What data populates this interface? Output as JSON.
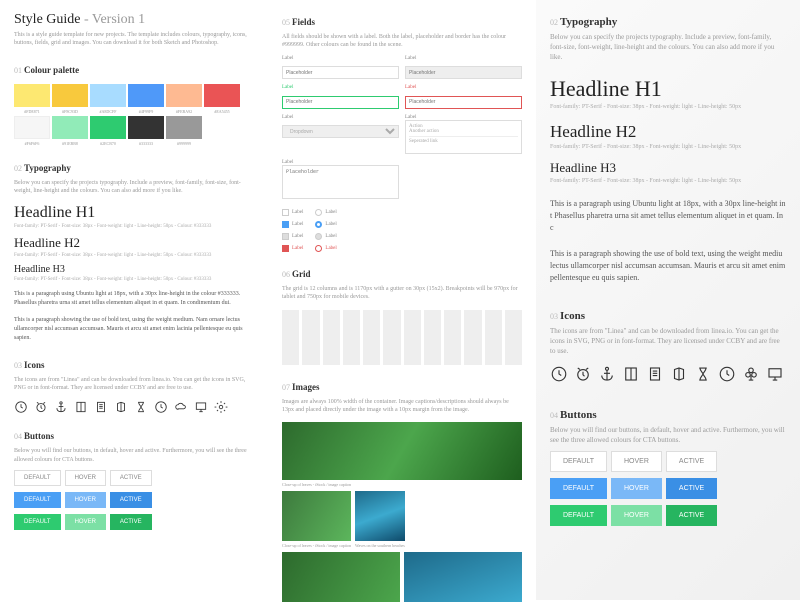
{
  "title": "Style Guide",
  "version": "- Version 1",
  "intro": "This is a style guide template for new projects. The template includes colours, typography, icons, buttons, fields, grid and images. You can download it for both Sketch and Photoshop.",
  "sections": {
    "palette": {
      "num": "01",
      "title": "Colour palette"
    },
    "typography": {
      "num": "02",
      "title": "Typography",
      "sub": "Below you can specify the projects typography. Include a preview, font-family, font-size, font-weight, line-height and the colours. You can also add more if you like."
    },
    "icons": {
      "num": "03",
      "title": "Icons",
      "sub": "The icons are from \"Linea\" and can be downloaded from linea.io. You can get the icons in SVG, PNG or in font-format. They are licensed under CCBY and are free to use."
    },
    "buttons": {
      "num": "04",
      "title": "Buttons",
      "sub": "Below you will find our buttons, in default, hover and active. Furthermore, you will see the three allowed colours for CTA buttons."
    },
    "fields": {
      "num": "05",
      "title": "Fields",
      "sub": "All fields should be shown with a label. Both the label, placeholder and border has the colour #999999. Other colours can be found in the scene."
    },
    "grid": {
      "num": "06",
      "title": "Grid",
      "sub": "The grid is 12 columns and is 1170px with a gutter on 30px (15x2). Breakpoints will be 970px for tablet and 750px for mobile devices."
    },
    "images": {
      "num": "07",
      "title": "Images",
      "sub": "Images are always 100% width of the container. Image captions/descriptions should always be 13px and placed directly under the image with a 10px margin from the image."
    }
  },
  "palette": [
    {
      "hex": "#FDE871",
      "label": "#FDE871"
    },
    {
      "hex": "#F8C93D",
      "label": "#F8C93D"
    },
    {
      "hex": "#A8DCFF",
      "label": "#A8DCFF"
    },
    {
      "hex": "#4F99F9",
      "label": "#4F99F9"
    },
    {
      "hex": "#FEBA92",
      "label": "#FEBA92"
    },
    {
      "hex": "#EA5455",
      "label": "#EA5455"
    },
    {
      "hex": "#F6F6F6",
      "label": "#F6F6F6"
    },
    {
      "hex": "#91EBB8",
      "label": "#91EBB8"
    },
    {
      "hex": "#2ECB70",
      "label": "#2ECB70"
    },
    {
      "hex": "#333333",
      "label": "#333333"
    },
    {
      "hex": "#999999",
      "label": "#999999"
    }
  ],
  "headlines": {
    "h1": "Headline H1",
    "h2": "Headline H2",
    "h3": "Headline H3",
    "meta1": "Font-family: PT-Serif  -  Font-size: 38px  -  Font-weight: light  -  Line-height: 50px  -  Colour: #333333",
    "meta2": "Font-family: PT-Serif  -  Font-size: 38px  -  Font-weight: light  -  Line-height: 50px  -  Colour: #333333",
    "meta3": "Font-family: PT-Serif  -  Font-size: 38px  -  Font-weight: light  -  Line-height: 50px  -  Colour: #333333",
    "meta1b": "Font-family: PT-Serif  -  Font-size: 38px  -  Font-weight: light  -  Line-height: 50px",
    "meta2b": "Font-family: PT-Serif  -  Font-size: 38px  -  Font-weight: light  -  Line-height: 50px",
    "meta3b": "Font-family: PT-Serif  -  Font-size: 38px  -  Font-weight: light  -  Line-height: 50px"
  },
  "paragraphs": {
    "p1": "This is a paragraph using Ubuntu light at 18px, with a 30px line-height in the colour #333333. Phasellus pharetra urna sit amet tellus elementum aliquet in et quam. In condimentum dui.",
    "p2": "This is a paragraph showing the use of bold text, using the weight medium. Nam ornare lectus ullamcorper nisl accumsan accumsan. Mauris et arcu sit amet enim lacinia pellentesque eu quis sapien.",
    "p1b": "This is a paragraph using Ubuntu light at 18px, with a 30px line-height in t Phasellus pharetra urna sit amet tellus elementum aliquet in et quam. In c",
    "p2b": "This is a paragraph showing the use of bold text, using the weight mediu lectus ullamcorper nisl accumsan accumsan. Mauris et arcu sit amet enim pellentesque eu quis sapien."
  },
  "buttons": {
    "default": "DEFAULT",
    "hover": "HOVER",
    "active": "ACTIVE"
  },
  "fields": {
    "label": "Label",
    "placeholder": "Placeholder",
    "dropdown": "Dropdown",
    "action": "Action",
    "another": "Another action",
    "sep": "Seperated link"
  },
  "images": {
    "cap1": "Close-up of leaves - iStock / image caption",
    "cap2": "Waves on the southern beaches"
  }
}
